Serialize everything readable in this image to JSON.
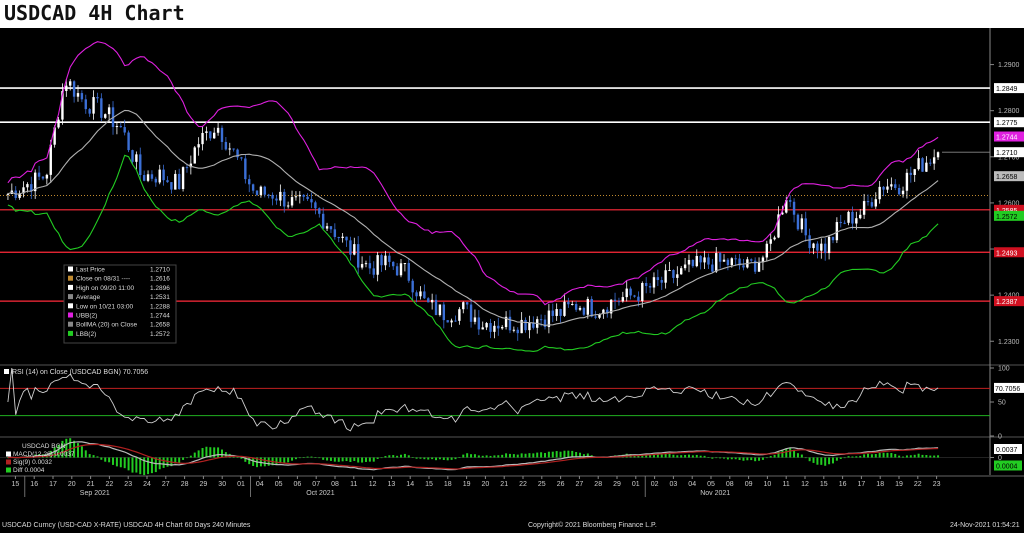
{
  "title": "USDCAD 4H Chart",
  "footer": {
    "left": "USDCAD Curncy (USD-CAD X-RATE) USDCAD 4H Chart 60 Days 240 Minutes",
    "center": "Copyright© 2021 Bloomberg Finance L.P.",
    "right": "24-Nov-2021 01:54:21"
  },
  "legend": {
    "last_price": {
      "label": "Last Price",
      "value": "1.2710"
    },
    "close_on": {
      "label": "Close on 08/31 ----",
      "value": "1.2616"
    },
    "high_on": {
      "label": "High on 09/20 11:00",
      "value": "1.2896"
    },
    "average": {
      "label": "Average",
      "value": "1.2531"
    },
    "low_on": {
      "label": "Low on 10/21 03:00",
      "value": "1.2288"
    },
    "ubb": {
      "label": "UBB(2)",
      "value": "1.2744"
    },
    "bollma": {
      "label": "BollMA (20)  on Close",
      "value": "1.2658"
    },
    "lbb": {
      "label": "LBB(2)",
      "value": "1.2572"
    }
  },
  "rsi_label": "RSI (14)  on Close (USDCAD BGN) 70.7056",
  "macd_legend": {
    "title": "USDCAD BGN",
    "macd": "MACD(12,26) 0.0037",
    "sig": "Sig(9) 0.0032",
    "diff": "Diff 0.0004"
  },
  "colors": {
    "candle_up": "#ffffff",
    "candle_down": "#3b6fd6",
    "ubb": "#e020e0",
    "bollma": "#b0b0b0",
    "lbb": "#22cc22",
    "level_white": "#ffffff",
    "level_red": "#ff2a3a",
    "close_dotted": "#c08a30",
    "rsi_line": "#d0d0d0",
    "rsi_upper": "#c02020",
    "rsi_lower": "#20b020",
    "macd_up": "#bbbbbb",
    "macd_down": "#b02020",
    "diff": "#22cc22"
  },
  "chart_data": {
    "type": "candlestick",
    "title": "USDCAD 4H Chart",
    "price_axis": {
      "ticks": [
        1.23,
        1.24,
        1.25,
        1.26,
        1.27,
        1.28,
        1.29
      ],
      "tick_labels": [
        "1.2300",
        "1.2400",
        "",
        "1.2600",
        "1.2700",
        "1.2800",
        "1.2900"
      ],
      "ylim": [
        1.2255,
        1.2975
      ]
    },
    "horizontal_levels": [
      {
        "value": 1.2849,
        "label": "1.2849",
        "color": "white"
      },
      {
        "value": 1.2775,
        "label": "1.2775",
        "color": "white"
      },
      {
        "value": 1.2585,
        "label": "1.2585",
        "color": "red"
      },
      {
        "value": 1.2493,
        "label": "1.2493",
        "color": "red"
      },
      {
        "value": 1.2387,
        "label": "1.2387",
        "color": "red"
      }
    ],
    "close_reference": {
      "value": 1.2616
    },
    "last_price_marker": {
      "value": 1.271,
      "label": "1.2710"
    },
    "ubb_marker": {
      "value": 1.2744,
      "label": "1.2744"
    },
    "bollma_marker": {
      "value": 1.2658,
      "label": "1.2658"
    },
    "lbb_marker": {
      "value": 1.2572,
      "label": "1.2572"
    },
    "x_axis": {
      "day_labels": [
        "15",
        "16",
        "17",
        "20",
        "21",
        "22",
        "23",
        "24",
        "27",
        "28",
        "29",
        "30",
        "01",
        "04",
        "05",
        "06",
        "07",
        "08",
        "11",
        "12",
        "13",
        "14",
        "15",
        "18",
        "19",
        "20",
        "21",
        "22",
        "25",
        "26",
        "27",
        "28",
        "29",
        "01",
        "02",
        "03",
        "04",
        "05",
        "08",
        "09",
        "10",
        "11",
        "12",
        "15",
        "16",
        "17",
        "18",
        "19",
        "22",
        "23"
      ],
      "month_labels": [
        {
          "label": "Sep 2021",
          "after_day_index": 0
        },
        {
          "label": "Oct 2021",
          "after_day_index": 12
        },
        {
          "label": "Nov 2021",
          "after_day_index": 33
        }
      ]
    },
    "price_path": [
      [
        0,
        1.262
      ],
      [
        1,
        1.264
      ],
      [
        2,
        1.266
      ],
      [
        3,
        1.287
      ],
      [
        4,
        1.282
      ],
      [
        5,
        1.28
      ],
      [
        6,
        1.276
      ],
      [
        7,
        1.266
      ],
      [
        8,
        1.266
      ],
      [
        9,
        1.264
      ],
      [
        10,
        1.273
      ],
      [
        11,
        1.277
      ],
      [
        12,
        1.27
      ],
      [
        13,
        1.262
      ],
      [
        14,
        1.262
      ],
      [
        15,
        1.26
      ],
      [
        16,
        1.259
      ],
      [
        17,
        1.255
      ],
      [
        18,
        1.25
      ],
      [
        19,
        1.246
      ],
      [
        20,
        1.247
      ],
      [
        21,
        1.245
      ],
      [
        22,
        1.238
      ],
      [
        23,
        1.236
      ],
      [
        24,
        1.237
      ],
      [
        25,
        1.234
      ],
      [
        26,
        1.234
      ],
      [
        27,
        1.234
      ],
      [
        28,
        1.235
      ],
      [
        29,
        1.236
      ],
      [
        30,
        1.238
      ],
      [
        31,
        1.237
      ],
      [
        32,
        1.239
      ],
      [
        33,
        1.24
      ],
      [
        34,
        1.242
      ],
      [
        35,
        1.244
      ],
      [
        36,
        1.246
      ],
      [
        37,
        1.247
      ],
      [
        38,
        1.247
      ],
      [
        39,
        1.246
      ],
      [
        40,
        1.249
      ],
      [
        41,
        1.262
      ],
      [
        42,
        1.253
      ],
      [
        43,
        1.25
      ],
      [
        44,
        1.256
      ],
      [
        45,
        1.258
      ],
      [
        46,
        1.264
      ],
      [
        47,
        1.264
      ],
      [
        48,
        1.268
      ],
      [
        49,
        1.271
      ]
    ],
    "rsi": {
      "label": "RSI (14)  on Close (USDCAD BGN) 70.7056",
      "last": 70.7056,
      "ticks": [
        0,
        50,
        100
      ],
      "upper": 70,
      "lower": 30,
      "last_label": "70.7056"
    },
    "macd": {
      "macd": 0.0037,
      "signal": 0.0032,
      "diff": 0.0004,
      "ticks": [
        0.0
      ],
      "last_label": "0.0037",
      "diff_label": "0.0004"
    }
  }
}
